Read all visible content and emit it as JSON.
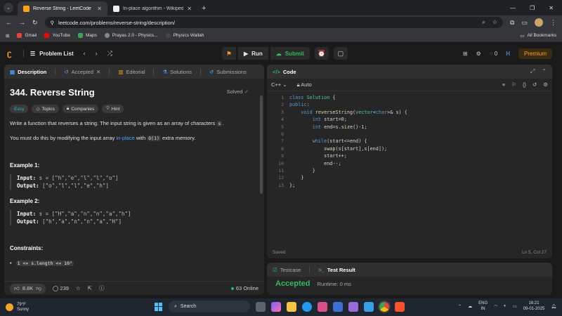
{
  "browser": {
    "tabs": [
      {
        "title": "Reverse String - LeetCode",
        "favicon_color": "#ffa116",
        "active": true
      },
      {
        "title": "In-place algorithm - Wikipedia",
        "favicon_color": "#eeeeee",
        "active": false
      }
    ],
    "url": "leetcode.com/problems/reverse-string/description/",
    "bookmarks": [
      {
        "label": "Gmail",
        "color": "#ea4335"
      },
      {
        "label": "YouTube",
        "color": "#ff0000"
      },
      {
        "label": "Maps",
        "color": "#34a853"
      },
      {
        "label": "Prayas 2.0 - Physics...",
        "color": "#888888"
      },
      {
        "label": "Physics Wallah",
        "color": "#444444"
      }
    ],
    "all_bookmarks": "All Bookmarks"
  },
  "nav": {
    "problem_list": "Problem List",
    "run": "Run",
    "submit": "Submit",
    "fire_count": "0",
    "premium": "Premium"
  },
  "desc": {
    "tabs": {
      "description": "Description",
      "accepted": "Accepted",
      "editorial": "Editorial",
      "solutions": "Solutions",
      "submissions": "Submissions"
    },
    "title": "344. Reverse String",
    "solved": "Solved",
    "tags": {
      "easy": "Easy",
      "topics": "Topics",
      "companies": "Companies",
      "hint": "Hint"
    },
    "p1_a": "Write a function that reverses a string. The input string is given as an array of characters ",
    "p1_code": "s",
    "p1_b": ".",
    "p2_a": "You must do this by modifying the input array ",
    "p2_link": "in-place",
    "p2_b": " with ",
    "p2_code": "O(1)",
    "p2_c": " extra memory.",
    "ex1_title": "Example 1:",
    "ex1_input_label": "Input:",
    "ex1_input": "s = [\"h\",\"e\",\"l\",\"l\",\"o\"]",
    "ex1_output_label": "Output:",
    "ex1_output": "[\"o\",\"l\",\"l\",\"e\",\"h\"]",
    "ex2_title": "Example 2:",
    "ex2_input_label": "Input:",
    "ex2_input": "s = [\"H\",\"a\",\"n\",\"n\",\"a\",\"h\"]",
    "ex2_output_label": "Output:",
    "ex2_output": "[\"h\",\"a\",\"n\",\"n\",\"a\",\"H\"]",
    "constraints_title": "Constraints:",
    "constraint1": "1 <= s.length <= 10⁵",
    "likes": "8.8K",
    "comments": "239",
    "online": "63 Online"
  },
  "code": {
    "title": "Code",
    "language": "C++",
    "auto": "Auto",
    "line_numbers": [
      "1",
      "2",
      "3",
      "4",
      "5",
      "6",
      "7",
      "8",
      "9",
      "10",
      "11",
      "12",
      "13"
    ],
    "status": "Saved",
    "cursor": "Ln 5, Col 27"
  },
  "test": {
    "tab_testcase": "Testcase",
    "tab_result": "Test Result",
    "verdict": "Accepted",
    "runtime": "Runtime: 0 ms"
  },
  "taskbar": {
    "temp": "79°F",
    "weather": "Sunny",
    "search": "Search",
    "lang1": "ENG",
    "lang2": "IN",
    "time": "16:21",
    "date": "09-01-2025"
  }
}
